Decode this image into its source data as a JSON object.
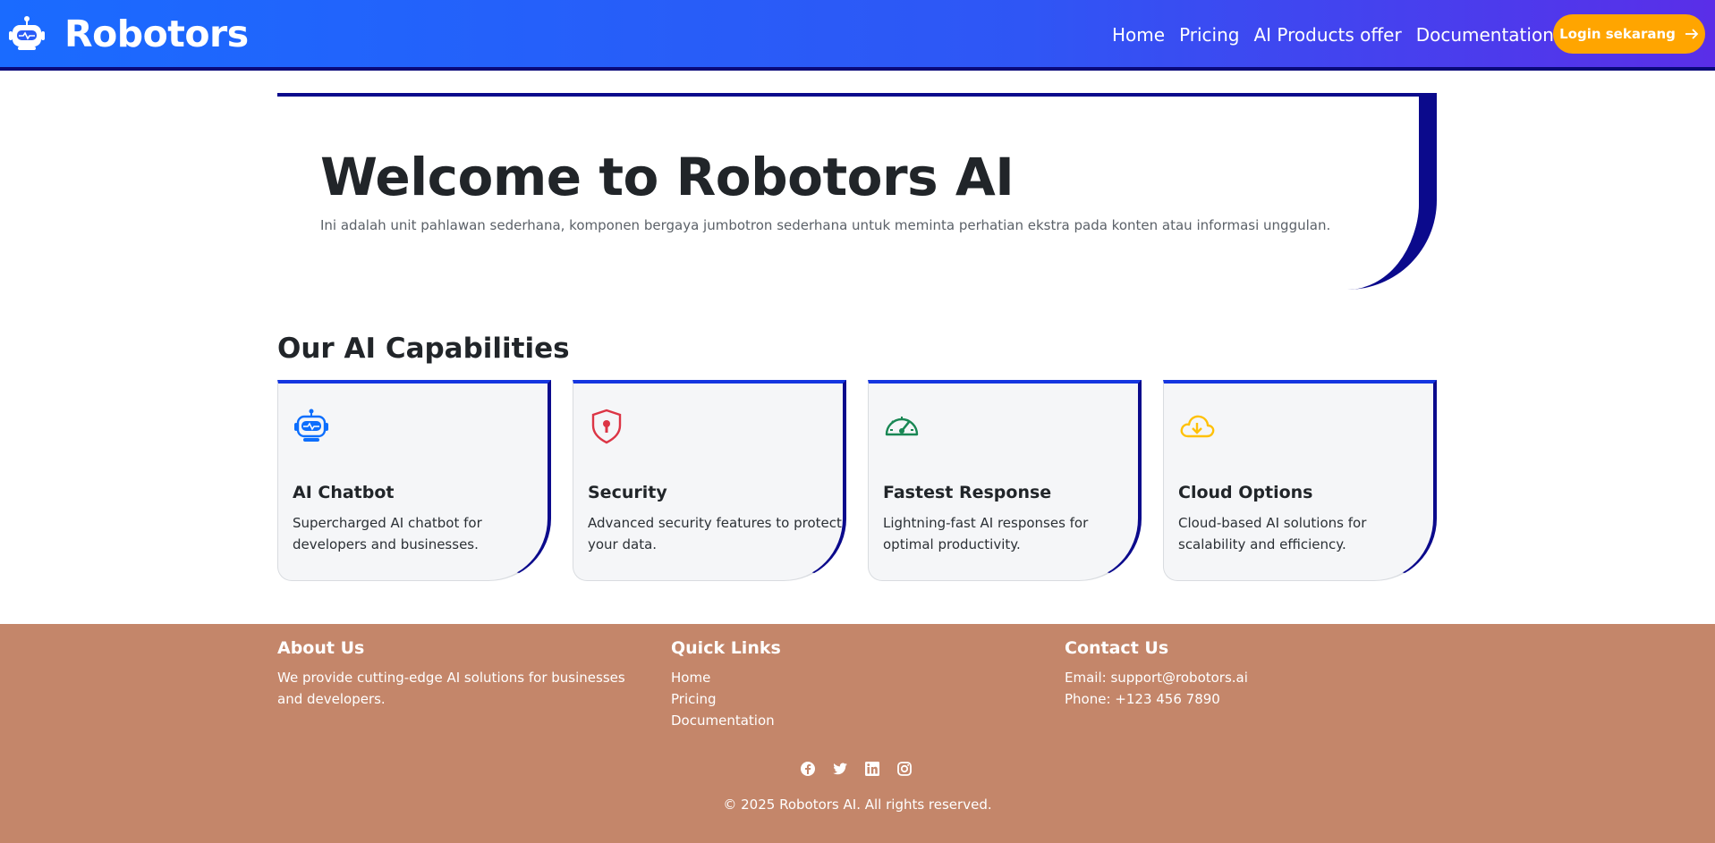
{
  "brand": {
    "name": "Robotors",
    "icon": "robot-icon"
  },
  "nav": {
    "items": [
      {
        "label": "Home"
      },
      {
        "label": "Pricing"
      },
      {
        "label": "AI Products offer"
      },
      {
        "label": "Documentation",
        "dropdown": true
      }
    ],
    "login_label": "Login sekarang"
  },
  "hero": {
    "title": "Welcome to Robotors AI",
    "subtitle": "Ini adalah unit pahlawan sederhana, komponen bergaya jumbotron sederhana untuk meminta perhatian ekstra pada konten atau informasi unggulan."
  },
  "capabilities": {
    "title": "Our AI Capabilities",
    "cards": [
      {
        "icon": "robot-icon",
        "color": "#0d6efd",
        "title": "AI Chatbot",
        "text": "Supercharged AI chatbot for developers and businesses."
      },
      {
        "icon": "shield-lock-icon",
        "color": "#dc3545",
        "title": "Security",
        "text": "Advanced security features to protect your data."
      },
      {
        "icon": "speedometer-icon",
        "color": "#198754",
        "title": "Fastest Response",
        "text": "Lightning-fast AI responses for optimal productivity."
      },
      {
        "icon": "cloud-download-icon",
        "color": "#ffc107",
        "title": "Cloud Options",
        "text": "Cloud-based AI solutions for scalability and efficiency."
      }
    ]
  },
  "footer": {
    "about": {
      "title": "About Us",
      "text": "We provide cutting-edge AI solutions for businesses and developers."
    },
    "links": {
      "title": "Quick Links",
      "items": [
        "Home",
        "Pricing",
        "Documentation"
      ]
    },
    "contact": {
      "title": "Contact Us",
      "email": "Email: support@robotors.ai",
      "phone": "Phone: +123 456 7890"
    },
    "social": [
      "facebook-icon",
      "twitter-icon",
      "linkedin-icon",
      "instagram-icon"
    ],
    "copyright": "© 2025 Robotors AI. All rights reserved."
  },
  "colors": {
    "accent": "#ffa500",
    "nav_start": "#1a6bff",
    "nav_end": "#5a2ee8",
    "dark_border": "#0b0a8c",
    "footer_bg": "#c4866a"
  }
}
